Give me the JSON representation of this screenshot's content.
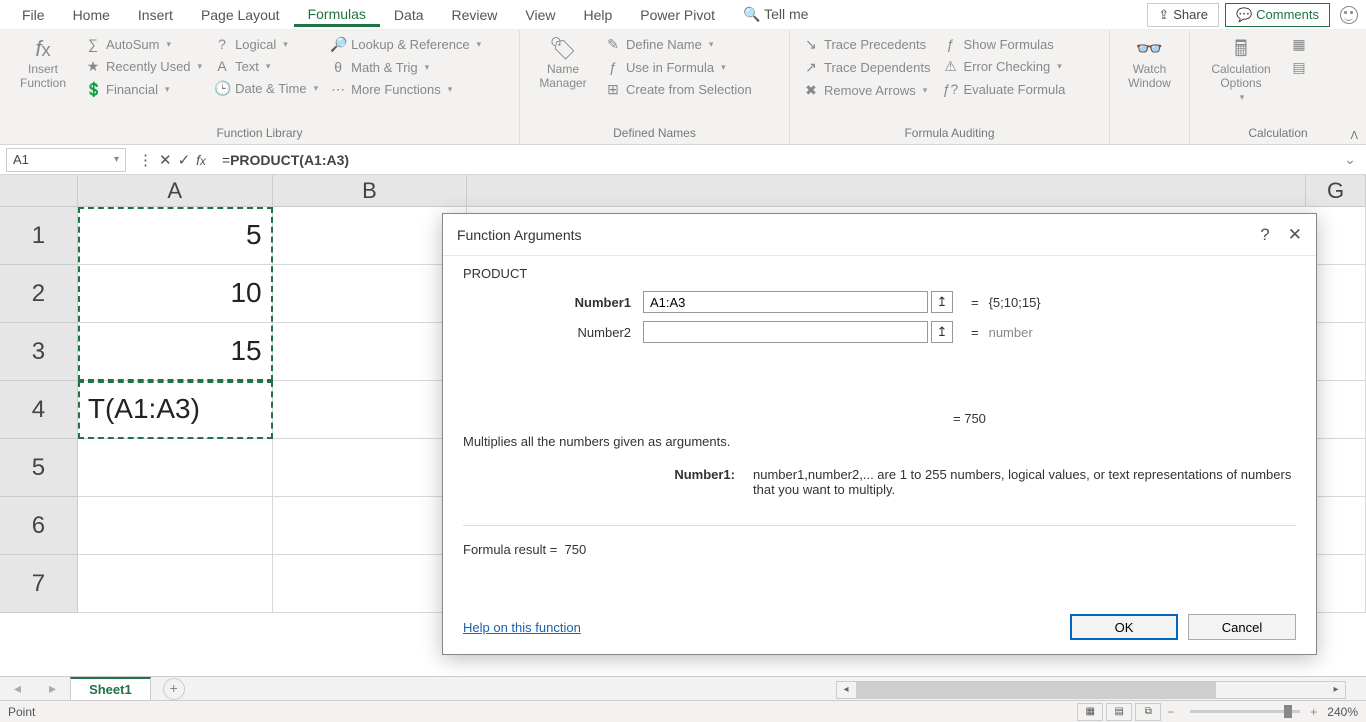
{
  "menu": {
    "tabs": [
      "File",
      "Home",
      "Insert",
      "Page Layout",
      "Formulas",
      "Data",
      "Review",
      "View",
      "Help",
      "Power Pivot"
    ],
    "active": "Formulas",
    "tellme_icon": "🔍",
    "tellme": "Tell me",
    "share": "Share",
    "comments": "Comments"
  },
  "ribbon": {
    "insert_function": "Insert Function",
    "autosum": "AutoSum",
    "recently": "Recently Used",
    "financial": "Financial",
    "logical": "Logical",
    "text": "Text",
    "datetime": "Date & Time",
    "lookup": "Lookup & Reference",
    "mathtrig": "Math & Trig",
    "morefn": "More Functions",
    "group1": "Function Library",
    "name_manager": "Name Manager",
    "define_name": "Define Name",
    "use_in_formula": "Use in Formula",
    "create_sel": "Create from Selection",
    "group2": "Defined Names",
    "trace_prec": "Trace Precedents",
    "trace_dep": "Trace Dependents",
    "remove_arrows": "Remove Arrows",
    "show_formulas": "Show Formulas",
    "error_check": "Error Checking",
    "eval_formula": "Evaluate Formula",
    "group3": "Formula Auditing",
    "watch": "Watch Window",
    "calc_opts": "Calculation Options",
    "group4": "Calculation"
  },
  "namebox": "A1",
  "formula": "=PRODUCT(A1:A3)",
  "cols": {
    "A": "A",
    "B": "B",
    "G": "G"
  },
  "rows": [
    "1",
    "2",
    "3",
    "4",
    "5",
    "6",
    "7"
  ],
  "cells": {
    "A1": "5",
    "A2": "10",
    "A3": "15",
    "A4": "T(A1:A3)"
  },
  "dialog": {
    "title": "Function Arguments",
    "func": "PRODUCT",
    "arg1_label": "Number1",
    "arg1_value": "A1:A3",
    "arg1_result": "{5;10;15}",
    "arg2_label": "Number2",
    "arg2_result": "number",
    "result_eq": "750",
    "desc": "Multiplies all the numbers given as arguments.",
    "arg_help_label": "Number1:",
    "arg_help": "number1,number2,... are 1 to 255 numbers, logical values, or text representations of numbers that you want to multiply.",
    "formula_result_label": "Formula result  =",
    "formula_result": "750",
    "help": "Help on this function",
    "ok": "OK",
    "cancel": "Cancel"
  },
  "sheet": {
    "name": "Sheet1"
  },
  "status": {
    "mode": "Point",
    "zoom": "240%"
  }
}
